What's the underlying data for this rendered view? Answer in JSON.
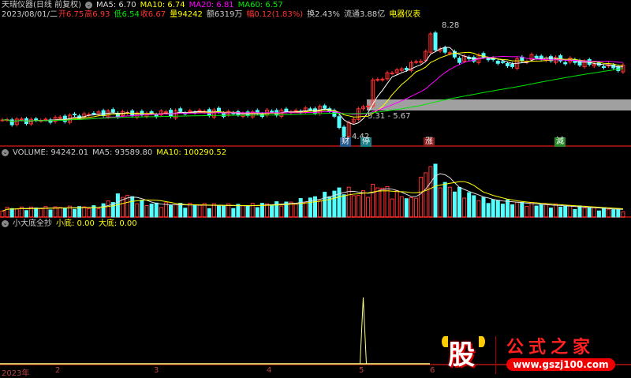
{
  "header": {
    "stock": "天瑞仪器(日线 前复权)",
    "ma5": "MA5: 6.70",
    "ma10": "MA10: 6.74",
    "ma20": "MA20: 6.81",
    "ma60": "MA60: 6.57"
  },
  "quote": {
    "date": "2023/08/01/二",
    "open": "开6.75",
    "high": "高6.93",
    "low": "低6.54",
    "close": "收6.67",
    "vol": "量94242",
    "amount": "额6319万",
    "change": "幅0.12(1.83%)",
    "turnover": "换2.43%",
    "float": "流通3.88亿",
    "sector": "电器仪表"
  },
  "price_labels": {
    "high": "8.28",
    "low": "4.42",
    "range": "5.31 - 5.67"
  },
  "tags": {
    "cai": "财",
    "ting": "停",
    "zhang": "涨",
    "jian": "減"
  },
  "volume_panel": {
    "title": "VOLUME: 94242.01",
    "ma5": "MA5: 93589.80",
    "ma10": "MA10: 100290.52"
  },
  "indicator_panel": {
    "title": "小大底全抄",
    "small": "小底: 0.00",
    "big": "大底: 0.00"
  },
  "time_axis": [
    "2023年",
    "2",
    "3",
    "4",
    "5",
    "6"
  ],
  "watermark": {
    "char": "股",
    "name": "公式之家",
    "url": "www.gszj100.com"
  },
  "colors": {
    "up": "#ff3232",
    "down": "#54ffff",
    "ma5": "#ffffff",
    "ma10": "#ffff00",
    "ma20": "#ff00ff",
    "ma60": "#00e600"
  },
  "chart_data": {
    "type": "candlestick",
    "bars": 130,
    "close_keypoints": [
      [
        0,
        4.95
      ],
      [
        10,
        5.0
      ],
      [
        20,
        5.25
      ],
      [
        30,
        5.2
      ],
      [
        40,
        5.3
      ],
      [
        50,
        5.2
      ],
      [
        60,
        5.3
      ],
      [
        68,
        5.4
      ],
      [
        71,
        4.42
      ],
      [
        72,
        4.9
      ],
      [
        74,
        5.3
      ],
      [
        76,
        5.6
      ],
      [
        77,
        6.3
      ],
      [
        80,
        6.6
      ],
      [
        85,
        6.9
      ],
      [
        88,
        7.3
      ],
      [
        89,
        8.0
      ],
      [
        90,
        7.5
      ],
      [
        92,
        7.4
      ],
      [
        95,
        7.1
      ],
      [
        100,
        7.2
      ],
      [
        105,
        6.9
      ],
      [
        110,
        7.2
      ],
      [
        120,
        7.0
      ],
      [
        129,
        6.8
      ]
    ],
    "volume_keypoints": [
      [
        0,
        30
      ],
      [
        20,
        35
      ],
      [
        25,
        80
      ],
      [
        30,
        45
      ],
      [
        50,
        40
      ],
      [
        60,
        50
      ],
      [
        66,
        70
      ],
      [
        71,
        100
      ],
      [
        74,
        75
      ],
      [
        78,
        110
      ],
      [
        85,
        60
      ],
      [
        89,
        190
      ],
      [
        92,
        110
      ],
      [
        100,
        60
      ],
      [
        110,
        45
      ],
      [
        129,
        25
      ]
    ],
    "signal_bar": 75
  }
}
